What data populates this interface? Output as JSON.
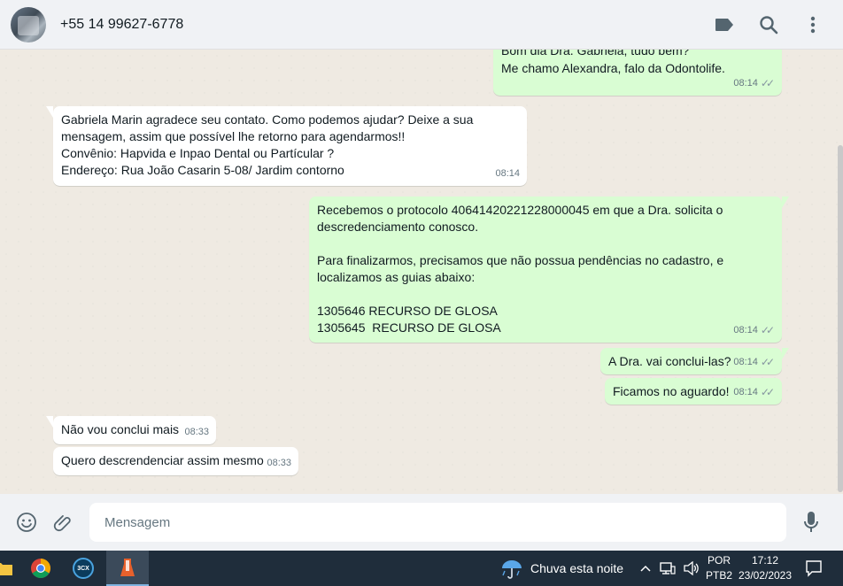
{
  "header": {
    "contact_name": "+55 14 99627-6778",
    "icons": [
      "label-icon",
      "search-icon",
      "more-vertical-icon"
    ]
  },
  "messages": [
    {
      "direction": "out",
      "text": "Bom dia Dra. Gabriela, tudo bem?",
      "time": "",
      "partial": true
    },
    {
      "direction": "out",
      "text": "Me chamo Alexandra, falo da Odontolife.",
      "time": "08:14"
    },
    {
      "direction": "in",
      "text": "Gabriela Marin agradece seu contato. Como podemos ajudar? Deixe a sua\nmensagem, assim que possível lhe retorno para agendarmos!!\nConvênio: Hapvida e Inpao Dental ou Partícular ?\nEndereço: Rua João Casarin 5-08/ Jardim contorno",
      "time": "08:14"
    },
    {
      "direction": "out",
      "text": "Recebemos o protocolo 40641420221228000045 em que a Dra. solicita o\ndescredenciamento conosco.\n\nPara finalizarmos, precisamos que não possua pendências no cadastro, e\nlocalizamos as guias abaixo:\n\n1305646 RECURSO DE GLOSA\n1305645  RECURSO DE GLOSA",
      "time": "08:14"
    },
    {
      "direction": "out",
      "text": "A Dra. vai conclui-las?",
      "time": "08:14"
    },
    {
      "direction": "out",
      "text": "Ficamos no aguardo!",
      "time": "08:14"
    },
    {
      "direction": "in",
      "text": "Não vou conclui mais",
      "time": "08:33"
    },
    {
      "direction": "in",
      "text": "Quero descrendenciar assim mesmo",
      "time": "08:33"
    }
  ],
  "composer": {
    "placeholder": "Mensagem",
    "icons": [
      "emoji-icon",
      "attach-icon",
      "microphone-icon"
    ]
  },
  "taskbar": {
    "apps": [
      "file-explorer-icon",
      "chrome-icon",
      "3cx-icon",
      "app-icon"
    ],
    "app_3cx_label": "3CX",
    "weather": "Chuva esta noite",
    "lang_line1": "POR",
    "lang_line2": "PTB2",
    "time": "17:12",
    "date": "23/02/2023"
  },
  "colors": {
    "incoming_bubble": "#ffffff",
    "outgoing_bubble": "#d9fdd3",
    "chat_background": "#efeae2",
    "header_background": "#f0f2f5",
    "taskbar_background": "#1f2d3b"
  }
}
